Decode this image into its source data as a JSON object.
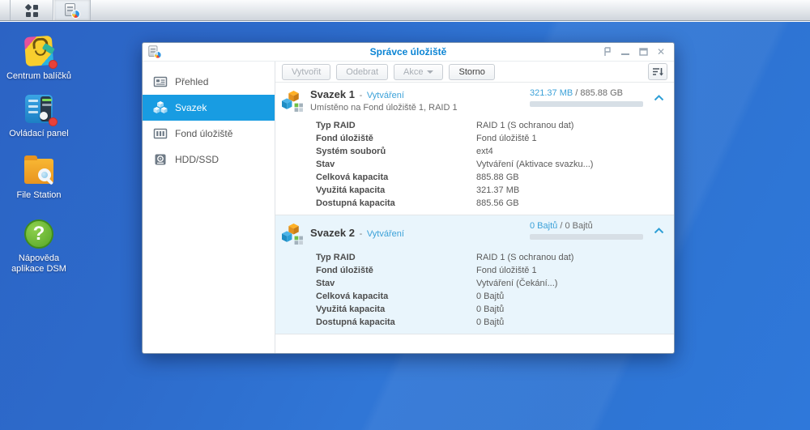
{
  "strings": {
    "dash": "-",
    "slash": "/"
  },
  "colors": {
    "accent_blue": "#189ce2",
    "link_blue": "#3ba1d8",
    "title_blue": "#0a84d4",
    "desktop_blue": "#2f6fd0",
    "volume2_bg": "#e9f5fc"
  },
  "taskbar": {
    "buttons": [
      {
        "icon": "main-menu-grid-icon"
      },
      {
        "icon": "storage-manager-app-icon",
        "active": true
      }
    ]
  },
  "desktop": {
    "icons": [
      {
        "label": "Centrum balíčků",
        "icon": "package-center-icon",
        "badge": true
      },
      {
        "label": "Ovládací panel",
        "icon": "control-panel-icon",
        "badge": true
      },
      {
        "label": "File Station",
        "icon": "file-station-icon",
        "badge": false
      },
      {
        "label": "Nápověda aplikace DSM",
        "icon": "dsm-help-icon",
        "badge": false
      }
    ]
  },
  "window": {
    "title": "Správce úložiště",
    "controls": [
      {
        "icon": "pin-icon"
      },
      {
        "icon": "minimize-icon"
      },
      {
        "icon": "maximize-icon"
      },
      {
        "icon": "close-icon",
        "glyph": "✕"
      }
    ]
  },
  "sidebar": {
    "items": [
      {
        "label": "Přehled",
        "icon": "overview-icon",
        "selected": false
      },
      {
        "label": "Svazek",
        "icon": "volume-cubes-icon",
        "selected": true
      },
      {
        "label": "Fond úložiště",
        "icon": "storage-pool-icon",
        "selected": false
      },
      {
        "label": "HDD/SSD",
        "icon": "disk-icon",
        "selected": false
      }
    ]
  },
  "toolbar": {
    "buttons": [
      {
        "label": "Vytvořit",
        "enabled": false
      },
      {
        "label": "Odebrat",
        "enabled": false
      },
      {
        "label": "Akce",
        "enabled": false,
        "dropdown": true
      },
      {
        "label": "Storno",
        "enabled": true
      }
    ],
    "sort_icon": "sort-collapse-icon"
  },
  "volumes": [
    {
      "title": "Svazek 1",
      "status": "Vytváření",
      "subtitle": "Umístěno na Fond úložiště 1, RAID 1",
      "used": "321.37 MB",
      "total": "885.88 GB",
      "usage_percent": 0,
      "rows": [
        {
          "label": "Typ RAID",
          "value": "RAID 1 (S ochranou dat)"
        },
        {
          "label": "Fond úložiště",
          "value": "Fond úložiště 1"
        },
        {
          "label": "Systém souborů",
          "value": "ext4"
        },
        {
          "label": "Stav",
          "value": "Vytváření (Aktivace svazku...)"
        },
        {
          "label": "Celková kapacita",
          "value": "885.88 GB"
        },
        {
          "label": "Využitá kapacita",
          "value": "321.37 MB"
        },
        {
          "label": "Dostupná kapacita",
          "value": "885.56 GB"
        }
      ]
    },
    {
      "title": "Svazek 2",
      "status": "Vytváření",
      "used": "0 Bajtů",
      "total": "0 Bajtů",
      "usage_percent": 0,
      "rows": [
        {
          "label": "Typ RAID",
          "value": "RAID 1 (S ochranou dat)"
        },
        {
          "label": "Fond úložiště",
          "value": "Fond úložiště 1"
        },
        {
          "label": "Stav",
          "value": "Vytváření (Čekání...)"
        },
        {
          "label": "Celková kapacita",
          "value": "0 Bajtů"
        },
        {
          "label": "Využitá kapacita",
          "value": "0 Bajtů"
        },
        {
          "label": "Dostupná kapacita",
          "value": "0 Bajtů"
        }
      ]
    }
  ]
}
